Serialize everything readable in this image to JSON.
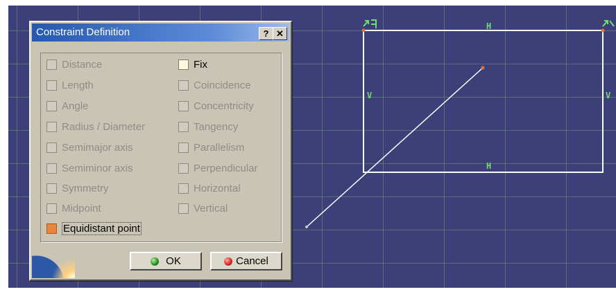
{
  "dialog": {
    "title": "Constraint Definition",
    "help_label": "?",
    "close_label": "✕",
    "left_options": [
      {
        "label": "Distance",
        "enabled": false
      },
      {
        "label": "Length",
        "enabled": false
      },
      {
        "label": "Angle",
        "enabled": false
      },
      {
        "label": "Radius / Diameter",
        "enabled": false
      },
      {
        "label": "Semimajor axis",
        "enabled": false
      },
      {
        "label": "Semiminor axis",
        "enabled": false
      },
      {
        "label": "Symmetry",
        "enabled": false
      },
      {
        "label": "Midpoint",
        "enabled": false
      },
      {
        "label": "Equidistant point",
        "enabled": true,
        "checked": true
      }
    ],
    "right_options": [
      {
        "label": "Fix",
        "enabled": true
      },
      {
        "label": "Coincidence",
        "enabled": false
      },
      {
        "label": "Concentricity",
        "enabled": false
      },
      {
        "label": "Tangency",
        "enabled": false
      },
      {
        "label": "Parallelism",
        "enabled": false
      },
      {
        "label": "Perpendicular",
        "enabled": false
      },
      {
        "label": "Horizontal",
        "enabled": false
      },
      {
        "label": "Vertical",
        "enabled": false
      }
    ],
    "ok_label": "OK",
    "cancel_label": "Cancel"
  },
  "sketch": {
    "constraint_labels": {
      "top_horizontal": "H",
      "bottom_horizontal": "H",
      "left_vertical": "V",
      "right_vertical": "V"
    },
    "colors": {
      "background": "#3c3f78",
      "geometry": "#ffffff",
      "constraint": "#6fe06f",
      "point": "#e8703a"
    }
  }
}
